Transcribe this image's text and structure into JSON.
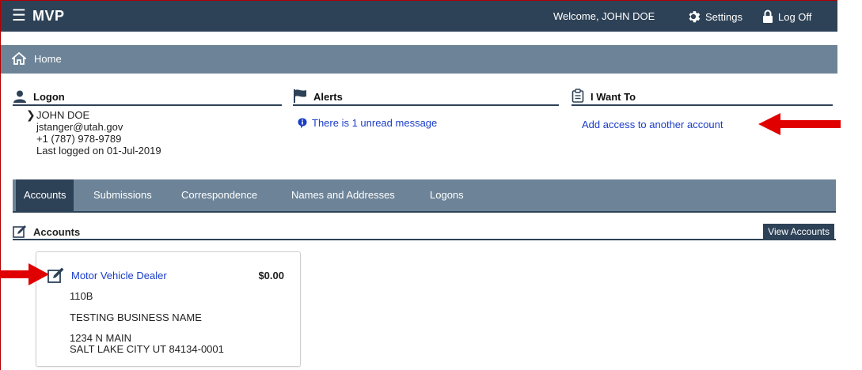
{
  "topbar": {
    "brand": "MVP",
    "welcome": "Welcome, JOHN DOE",
    "settings": "Settings",
    "logoff": "Log Off"
  },
  "subbar": {
    "home": "Home"
  },
  "logon": {
    "heading": "Logon",
    "name": "JOHN DOE",
    "email": "jstanger@utah.gov",
    "phone": "+1 (787) 978-9789",
    "last": "Last logged on 01-Jul-2019"
  },
  "alerts": {
    "heading": "Alerts",
    "message": "There is 1 unread message"
  },
  "iwant": {
    "heading": "I Want To",
    "link": "Add access to another account"
  },
  "tabs": [
    "Accounts",
    "Submissions",
    "Correspondence",
    "Names and Addresses",
    "Logons"
  ],
  "accounts": {
    "heading": "Accounts",
    "view_button": "View Accounts",
    "card": {
      "title": "Motor Vehicle Dealer",
      "amount": "$0.00",
      "id": "110B",
      "business": "TESTING BUSINESS NAME",
      "address1": "1234 N MAIN",
      "address2": "SALT LAKE CITY UT 84134-0001"
    }
  },
  "colors": {
    "header": "#2e4257",
    "subheader": "#6d8498",
    "link": "#1a3cc9",
    "annotation_arrow": "#e00000"
  }
}
